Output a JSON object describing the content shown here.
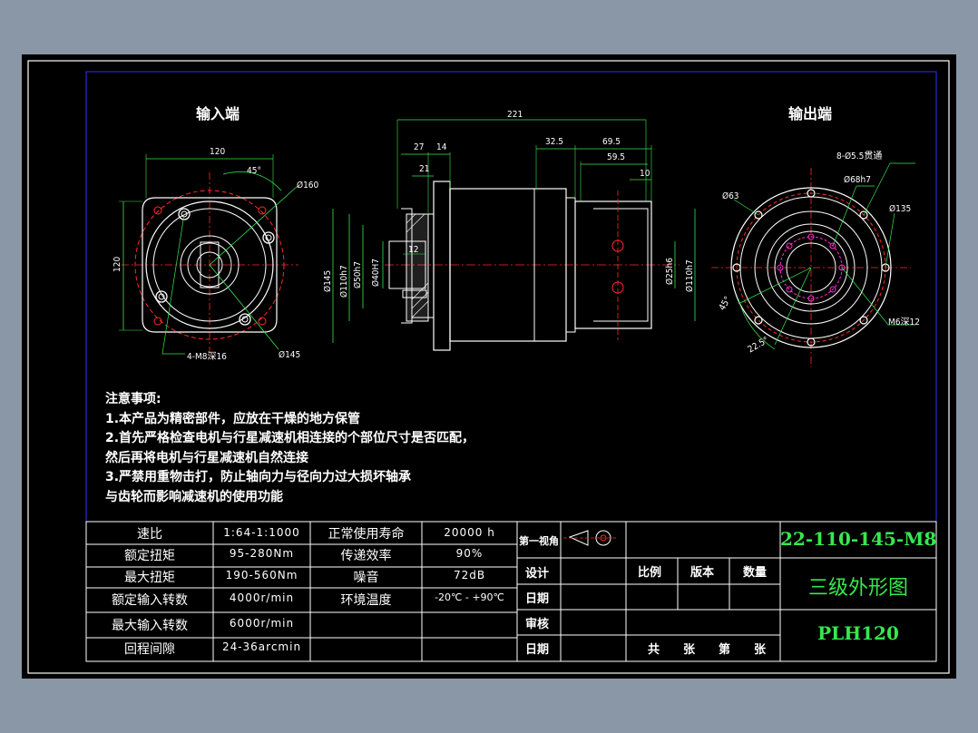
{
  "views": {
    "input_title": "输入端",
    "output_title": "输出端"
  },
  "dims": {
    "input": {
      "w": "120",
      "h": "120",
      "angle": "45°",
      "d160": "Ø160",
      "d145": "Ø145",
      "holes": "4-M8深16"
    },
    "side": {
      "total": "221",
      "d27": "27",
      "d14": "14",
      "d21": "21",
      "d12": "12",
      "d32": "32.5",
      "d69": "69.5",
      "d59": "59.5",
      "d10": "10",
      "phi145": "Ø145",
      "phi110": "Ø110h7",
      "phi50": "Ø50h7",
      "phi40": "Ø40H7",
      "phi25": "Ø25h6",
      "phi110b": "Ø110h7"
    },
    "output": {
      "holes8": "8-Ø5.5贯通",
      "d68": "Ø68h7",
      "d63": "Ø63",
      "d135": "Ø135",
      "angle45": "45°",
      "angle22": "22.5°",
      "m6": "M6深12"
    }
  },
  "notes": {
    "title": "注意事项:",
    "lines": [
      "1.本产品为精密部件，应放在干燥的地方保管",
      "2.首先严格检查电机与行星减速机相连接的个部位尺寸是否匹配，",
      "然后再将电机与行星减速机自然连接",
      "3.严禁用重物击打，防止轴向力与径向力过大损坏轴承",
      "与齿轮而影响减速机的使用功能"
    ]
  },
  "specs": [
    {
      "k": "速比",
      "v": "1:64-1:1000",
      "k2": "正常使用寿命",
      "v2": "20000 h"
    },
    {
      "k": "额定扭矩",
      "v": "95-280Nm",
      "k2": "传递效率",
      "v2": "90%"
    },
    {
      "k": "最大扭矩",
      "v": "190-560Nm",
      "k2": "噪音",
      "v2": "72dB"
    },
    {
      "k": "额定输入转数",
      "v": "4000r/min",
      "k2": "环境温度",
      "v2": "-20℃ - +90℃"
    },
    {
      "k": "最大输入转数",
      "v": "6000r/min",
      "k2": "",
      "v2": ""
    },
    {
      "k": "回程间隙",
      "v": "24-36arcmin",
      "k2": "",
      "v2": ""
    }
  ],
  "title_block": {
    "projection": "第一视角",
    "design": "设计",
    "date1": "日期",
    "review": "审核",
    "date2": "日期",
    "scale": "比例",
    "version": "版本",
    "quantity": "数量",
    "sheets": "共　　张　　第　　张",
    "drawing_no": "22-110-145-M8",
    "drawing_name": "三级外形图",
    "model": "PLH120"
  },
  "colors": {
    "border": "#2f2fff",
    "green": "#36e84e",
    "red": "#ff2a2a",
    "magenta": "#ff2ad0",
    "yellow": "#ffff00"
  }
}
